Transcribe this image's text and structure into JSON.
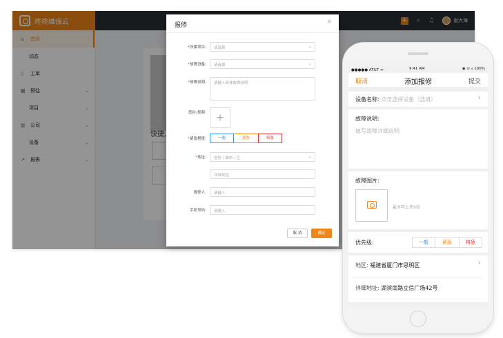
{
  "desktop": {
    "app_name": "咚咚维保云",
    "user_name": "谢大海",
    "sidebar": [
      {
        "label": "首页",
        "icon": "home-icon",
        "glyph": "⌂",
        "active": true,
        "sub": false,
        "expandable": false
      },
      {
        "label": "动态",
        "icon": "",
        "glyph": "",
        "active": false,
        "sub": true,
        "expandable": false
      },
      {
        "label": "工单",
        "icon": "document-icon",
        "glyph": "▯",
        "active": false,
        "sub": false,
        "expandable": false
      },
      {
        "label": "预估",
        "icon": "grid-icon",
        "glyph": "▦",
        "active": false,
        "sub": false,
        "expandable": true
      },
      {
        "label": "项目",
        "icon": "",
        "glyph": "",
        "active": false,
        "sub": true,
        "expandable": true
      },
      {
        "label": "公司",
        "icon": "company-icon",
        "glyph": "▥",
        "active": false,
        "sub": false,
        "expandable": true
      },
      {
        "label": "设备",
        "icon": "",
        "glyph": "",
        "active": false,
        "sub": true,
        "expandable": true
      },
      {
        "label": "报表",
        "icon": "chart-icon",
        "glyph": "↗",
        "active": false,
        "sub": false,
        "expandable": true
      }
    ],
    "content_heading": "快捷入",
    "modal": {
      "title": "报修",
      "close_glyph": "×",
      "fields": {
        "project": {
          "label": "所属项目:",
          "placeholder": "请选择"
        },
        "device": {
          "label": "故障设备:",
          "placeholder": "请选择"
        },
        "description": {
          "label": "故障说明:",
          "placeholder": "请输入具体故障说明"
        },
        "images": {
          "label": "图片/视频:",
          "add_glyph": "+"
        },
        "urgency": {
          "label": "紧急程度:",
          "options": [
            "一般",
            "紧急",
            "特急"
          ]
        },
        "address": {
          "label": "地址:",
          "region_placeholder": "省份 / 城市 / 区",
          "detail_placeholder": "详细地址"
        },
        "reporter": {
          "label": "报修人:",
          "placeholder": "请输入"
        },
        "phone": {
          "label": "手机号码:",
          "placeholder": "请输入"
        }
      },
      "cancel_label": "取 消",
      "confirm_label": "确定"
    }
  },
  "phone": {
    "status": {
      "carrier": "●●●●● AT&T ᯤ",
      "time": "9:41 AM",
      "battery": "◉ ⊙ ⁎ 100%"
    },
    "nav": {
      "back": "取消",
      "title": "添加报修",
      "submit": "提交"
    },
    "device": {
      "label": "设备名称:",
      "placeholder": "点击选择设备（选填）"
    },
    "description": {
      "label": "故障说明:",
      "placeholder": "填写故障详细说明"
    },
    "images": {
      "label": "故障图片:",
      "hint": "最多可上传9张"
    },
    "priority": {
      "label": "优先级:",
      "options": [
        "一般",
        "紧急",
        "特急"
      ]
    },
    "region": {
      "label": "地区:",
      "value": "福建省厦门市思明区"
    },
    "address": {
      "label": "详细地址:",
      "value": "湖滨南路立信广场42号"
    }
  }
}
